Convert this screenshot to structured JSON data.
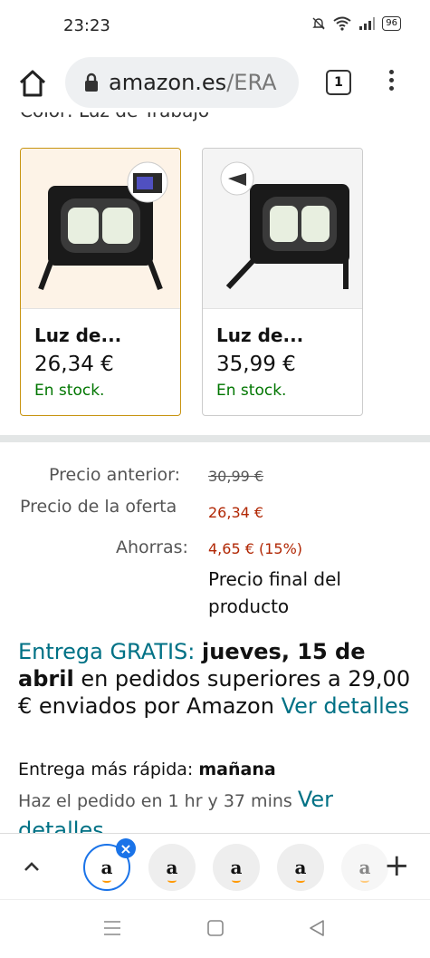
{
  "status": {
    "time": "23:23",
    "battery": "96"
  },
  "browser": {
    "url_host": "amazon.es",
    "url_path": "/ERA",
    "tab_count": "1"
  },
  "product": {
    "cut_off_label": "Color: Luz de Trabajo",
    "variants": [
      {
        "title": "Luz de...",
        "price": "26,34 €",
        "stock": "En stock.",
        "selected": true
      },
      {
        "title": "Luz de...",
        "price": "35,99 €",
        "stock": "En stock.",
        "selected": false
      }
    ]
  },
  "pricing": {
    "previous_label": "Precio anterior:",
    "previous_value": "30,99 €",
    "deal_label": "Precio de la oferta",
    "deal_value": "26,34 €",
    "savings_label": "Ahorras:",
    "savings_value": "4,65 € (15%)",
    "final_note": "Precio final del producto"
  },
  "delivery": {
    "free_label": "Entrega GRATIS:",
    "date_bold": "jueves, 15 de abril",
    "condition": "en pedidos superiores a 29,00 € enviados por Amazon",
    "details_link": "Ver detalles",
    "fastest_label": "Entrega más rápida:",
    "fastest_value": "mañana",
    "order_within": "Haz el pedido en 1 hr y 37 mins",
    "details_link2": "Ver detalles"
  },
  "tabbar": {
    "tab_glyph": "a",
    "close_glyph": "×",
    "add_glyph": "+"
  },
  "colors": {
    "accent_teal": "#007185",
    "price_red": "#b12704",
    "stock_green": "#007600",
    "selected_border": "#c89411",
    "tab_blue": "#1a73e8"
  }
}
